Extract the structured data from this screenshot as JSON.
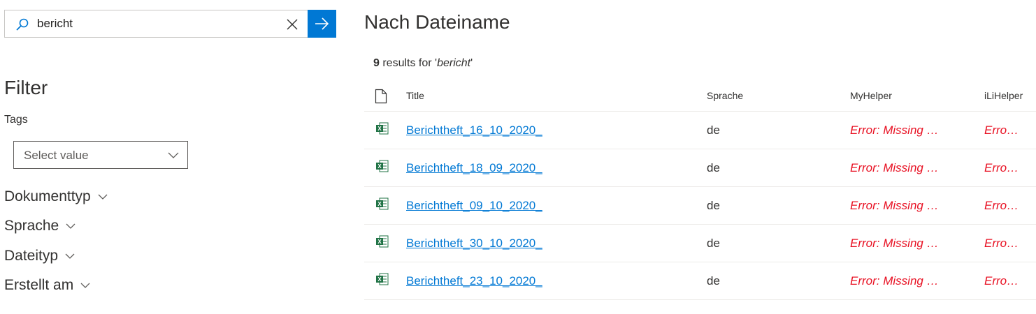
{
  "search": {
    "value": "bericht",
    "placeholder": ""
  },
  "filter": {
    "title": "Filter",
    "tags_label": "Tags",
    "tags_placeholder": "Select value",
    "refiners": [
      "Dokumenttyp",
      "Sprache",
      "Dateityp",
      "Erstellt am"
    ]
  },
  "results": {
    "title": "Nach Dateiname",
    "count": "9",
    "summary_text": " results for '",
    "query": "bericht",
    "summary_end": "'",
    "columns": {
      "title": "Title",
      "language": "Sprache",
      "myhelper": "MyHelper",
      "ilihelper": "iLiHelper"
    },
    "rows": [
      {
        "title": "Berichtheft_16_10_2020_",
        "language": "de",
        "myhelper": "Error: Missing helper",
        "ilihelper": "Error: Missing helper"
      },
      {
        "title": "Berichtheft_18_09_2020_",
        "language": "de",
        "myhelper": "Error: Missing helper",
        "ilihelper": "Error: Missing helper"
      },
      {
        "title": "Berichtheft_09_10_2020_",
        "language": "de",
        "myhelper": "Error: Missing helper",
        "ilihelper": "Error: Missing helper"
      },
      {
        "title": "Berichtheft_30_10_2020_",
        "language": "de",
        "myhelper": "Error: Missing helper",
        "ilihelper": "Error: Missing helper"
      },
      {
        "title": "Berichtheft_23_10_2020_",
        "language": "de",
        "myhelper": "Error: Missing helper",
        "ilihelper": "Error: Missing helper"
      }
    ]
  },
  "colors": {
    "accent": "#0078d4",
    "error": "#e81123",
    "excel": "#217346"
  }
}
